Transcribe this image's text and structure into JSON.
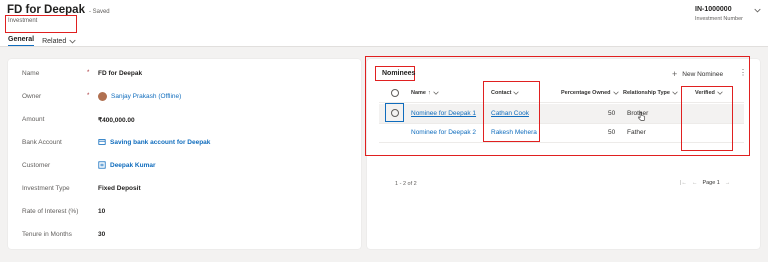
{
  "header": {
    "title": "FD for Deepak",
    "saved_status": "- Saved",
    "entity": "Investment",
    "record_number": "IN-1000000",
    "record_number_label": "Investment Number"
  },
  "tabs": [
    {
      "label": "General"
    },
    {
      "label": "Related"
    }
  ],
  "form": {
    "fields": [
      {
        "label": "Name",
        "value": "FD for Deepak",
        "required": "*"
      },
      {
        "label": "Owner",
        "value": "Sanjay Prakash (Offline)",
        "required": "*"
      },
      {
        "label": "Amount",
        "value": "₹400,000.00"
      },
      {
        "label": "Bank Account",
        "value": "Saving bank account for Deepak"
      },
      {
        "label": "Customer",
        "value": "Deepak Kumar"
      },
      {
        "label": "Investment Type",
        "value": "Fixed Deposit"
      },
      {
        "label": "Rate of Interest (%)",
        "value": "10"
      },
      {
        "label": "Tenure in Months",
        "value": "30"
      }
    ]
  },
  "nominees": {
    "title": "Nominees",
    "new_button": "New Nominee",
    "columns": {
      "name": "Name",
      "name_sort": "↑",
      "contact": "Contact",
      "percentage": "Percentage Owned",
      "relationship": "Relationship Type",
      "verified": "Verified"
    },
    "rows": [
      {
        "name": "Nominee for Deepak 1",
        "contact": "Cathan Cook",
        "percentage": "50",
        "relationship": "Brother",
        "verified": ""
      },
      {
        "name": "Nominee for Deepak 2",
        "contact": "Rakesh Mehera",
        "percentage": "50",
        "relationship": "Father",
        "verified": ""
      }
    ],
    "record_count": "1 - 2 of 2",
    "page_label": "Page 1"
  },
  "colors": {
    "accent": "#0f6cbd",
    "highlight_box": "#e02020",
    "background": "#f3f2f1"
  }
}
